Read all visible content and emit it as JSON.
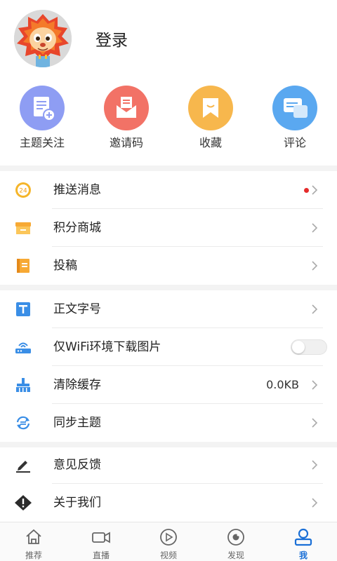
{
  "profile": {
    "login_label": "登录"
  },
  "quick_actions": [
    {
      "label": "主题关注",
      "icon": "subscribe-doc-icon",
      "color": "#8e9df3"
    },
    {
      "label": "邀请码",
      "icon": "envelope-icon",
      "color": "#f27266"
    },
    {
      "label": "收藏",
      "icon": "bookmark-icon",
      "color": "#f7b74d"
    },
    {
      "label": "评论",
      "icon": "chat-bubble-icon",
      "color": "#5aa8f0"
    }
  ],
  "menu": {
    "push": {
      "label": "推送消息",
      "badge_icon": "24"
    },
    "points_mall": {
      "label": "积分商城"
    },
    "contribute": {
      "label": "投稿"
    },
    "font_size": {
      "label": "正文字号"
    },
    "wifi_images": {
      "label": "仅WiFi环境下载图片"
    },
    "clear_cache": {
      "label": "清除缓存",
      "value": "0.0KB"
    },
    "sync_topics": {
      "label": "同步主题"
    },
    "feedback": {
      "label": "意见反馈"
    },
    "about": {
      "label": "关于我们"
    }
  },
  "tabs": [
    {
      "label": "推荐",
      "icon": "home-icon"
    },
    {
      "label": "直播",
      "icon": "video-camera-icon"
    },
    {
      "label": "视频",
      "icon": "play-circle-icon"
    },
    {
      "label": "发现",
      "icon": "discover-icon"
    },
    {
      "label": "我",
      "icon": "user-icon",
      "active": true
    }
  ],
  "colors": {
    "accent": "#1a6fd6",
    "badge_dot": "#e52b2b"
  }
}
